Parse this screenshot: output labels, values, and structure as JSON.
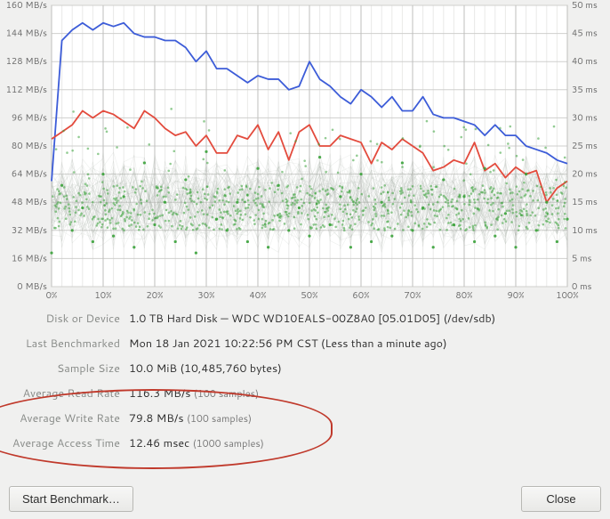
{
  "chart_data": {
    "type": "line",
    "x": [
      0,
      2,
      4,
      6,
      8,
      10,
      12,
      14,
      16,
      18,
      20,
      22,
      24,
      26,
      28,
      30,
      32,
      34,
      36,
      38,
      40,
      42,
      44,
      46,
      48,
      50,
      52,
      54,
      56,
      58,
      60,
      62,
      64,
      66,
      68,
      70,
      72,
      74,
      76,
      78,
      80,
      82,
      84,
      86,
      88,
      90,
      92,
      94,
      96,
      98,
      100
    ],
    "series": [
      {
        "name": "Read Rate (MB/s)",
        "color": "#3c5cd8",
        "axis": "left",
        "values": [
          60,
          140,
          146,
          150,
          146,
          150,
          148,
          150,
          144,
          142,
          142,
          140,
          140,
          136,
          128,
          134,
          124,
          124,
          120,
          116,
          120,
          118,
          118,
          112,
          114,
          128,
          118,
          114,
          108,
          104,
          112,
          108,
          102,
          108,
          100,
          100,
          108,
          98,
          96,
          96,
          94,
          92,
          86,
          92,
          86,
          86,
          80,
          78,
          76,
          72,
          70
        ]
      },
      {
        "name": "Write Rate (MB/s)",
        "color": "#e34b3d",
        "axis": "left",
        "values": [
          84,
          88,
          92,
          100,
          96,
          100,
          98,
          94,
          90,
          100,
          96,
          90,
          86,
          88,
          80,
          86,
          76,
          76,
          86,
          84,
          92,
          78,
          88,
          72,
          88,
          92,
          80,
          80,
          86,
          84,
          82,
          70,
          82,
          78,
          84,
          80,
          76,
          66,
          68,
          72,
          70,
          82,
          66,
          70,
          62,
          68,
          64,
          66,
          48,
          56,
          60
        ]
      },
      {
        "name": "Access Time (ms)",
        "color": "#3aa23a",
        "axis": "right",
        "style": "scatter",
        "values": [
          6,
          18,
          10,
          14,
          8,
          20,
          9,
          16,
          7,
          22,
          11,
          15,
          8,
          19,
          6,
          24,
          12,
          10,
          15,
          8,
          21,
          7,
          18,
          10,
          14,
          9,
          23,
          11,
          16,
          7,
          20,
          8,
          15,
          9,
          22,
          10,
          14,
          7,
          19,
          11,
          16,
          8,
          21,
          9,
          13,
          7,
          20,
          10,
          15,
          8,
          12
        ]
      }
    ],
    "xlabel": "",
    "ylabel_left": "MB/s",
    "ylabel_right": "ms",
    "x_ticks": [
      "0%",
      "10%",
      "20%",
      "30%",
      "40%",
      "50%",
      "60%",
      "70%",
      "80%",
      "90%",
      "100%"
    ],
    "y_left_ticks": [
      "0 MB/s",
      "16 MB/s",
      "32 MB/s",
      "48 MB/s",
      "64 MB/s",
      "80 MB/s",
      "96 MB/s",
      "112 MB/s",
      "128 MB/s",
      "144 MB/s",
      "160 MB/s"
    ],
    "y_right_ticks": [
      "0 ms",
      "5 ms",
      "10 ms",
      "15 ms",
      "20 ms",
      "25 ms",
      "30 ms",
      "35 ms",
      "40 ms",
      "45 ms",
      "50 ms"
    ],
    "ylim_left": [
      0,
      160
    ],
    "ylim_right": [
      0,
      50
    ]
  },
  "info": {
    "disk_or_device_label": "Disk or Device",
    "disk_or_device_value": "1.0 TB Hard Disk — WDC WD10EALS-00Z8A0 [05.01D05] (/dev/sdb)",
    "last_benchmarked_label": "Last Benchmarked",
    "last_benchmarked_value": "Mon 18 Jan 2021 10:22:56 PM CST (Less than a minute ago)",
    "sample_size_label": "Sample Size",
    "sample_size_value": "10.0 MiB (10,485,760 bytes)",
    "avg_read_label": "Average Read Rate",
    "avg_read_value": "116.3 MB/s",
    "avg_read_sub": "(100 samples)",
    "avg_write_label": "Average Write Rate",
    "avg_write_value": "79.8 MB/s",
    "avg_write_sub": "(100 samples)",
    "avg_access_label": "Average Access Time",
    "avg_access_value": "12.46 msec",
    "avg_access_sub": "(1000 samples)"
  },
  "buttons": {
    "start_benchmark": "Start Benchmark…",
    "close": "Close"
  }
}
